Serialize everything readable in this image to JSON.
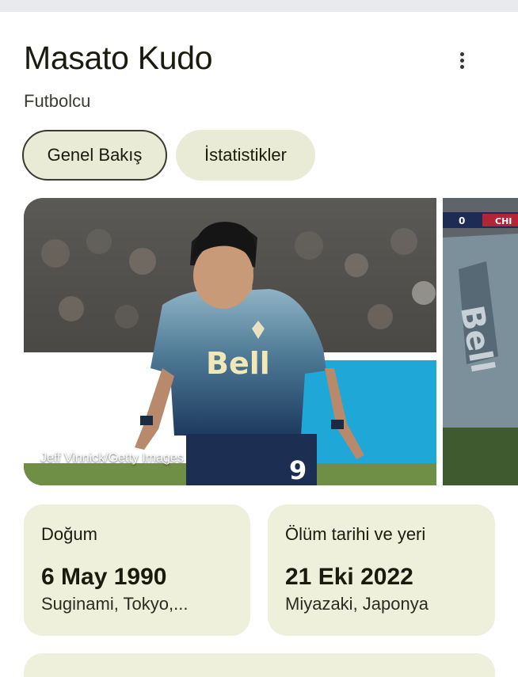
{
  "header": {
    "name": "Masato Kudo",
    "occupation": "Futbolcu",
    "more_icon": "more-vert-icon"
  },
  "tabs": [
    {
      "label": "Genel Bakış",
      "selected": true
    },
    {
      "label": "İstatistikler",
      "selected": false
    }
  ],
  "images": {
    "main_credit": "Jeff Vinnick/Getty Images",
    "side_score_left": "0",
    "side_score_right": "CHI",
    "jersey_text": "Bell",
    "jersey_number": "9"
  },
  "facts": {
    "birth": {
      "label": "Doğum",
      "value": "6 May 1990",
      "detail": "Suginami, Tokyo,..."
    },
    "death": {
      "label": "Ölüm tarihi ve yeri",
      "value": "21 Eki 2022",
      "detail": "Miyazaki, Japonya"
    }
  },
  "colors": {
    "chip_bg": "#eaebd6",
    "card_bg": "#eef0dc",
    "text": "#1a1a0f"
  }
}
